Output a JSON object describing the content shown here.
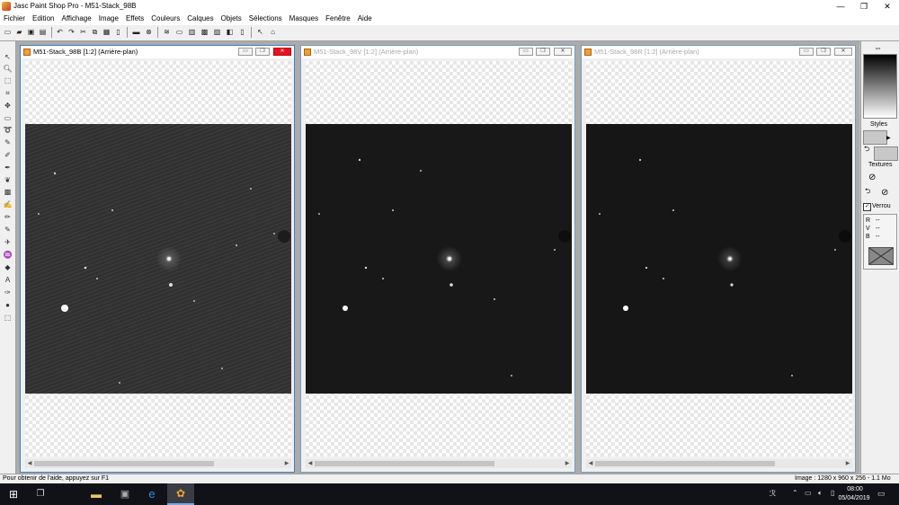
{
  "app": {
    "title": "Jasc Paint Shop Pro - M51-Stack_98B",
    "window_controls": {
      "minimize": "—",
      "maximize": "❐",
      "close": "✕"
    }
  },
  "menu": [
    "Fichier",
    "Edition",
    "Affichage",
    "Image",
    "Effets",
    "Couleurs",
    "Calques",
    "Objets",
    "Sélections",
    "Masques",
    "Fenêtre",
    "Aide"
  ],
  "windows": [
    {
      "title": "M51-Stack_98B [1:2] (Arrière-plan)",
      "active": true
    },
    {
      "title": "M51-Stack_98V [1:2] (Arrière-plan)",
      "active": false
    },
    {
      "title": "M51-Stack_98R [1:2] (Arrière-plan)",
      "active": false
    }
  ],
  "right_panel": {
    "styles_label": "Styles",
    "textures_label": "Textures",
    "verrou_label": "Verrou",
    "verrou_checked": true,
    "rgb": [
      {
        "label": "R",
        "value": "--"
      },
      {
        "label": "V",
        "value": "--"
      },
      {
        "label": "B",
        "value": "--"
      }
    ]
  },
  "status": {
    "help": "Pour obtenir de l'aide, appuyez sur F1",
    "image_info": "Image : 1280 x 960 x 256 - 1.1 Mo"
  },
  "taskbar": {
    "time": "08:00",
    "date": "05/04/2019"
  },
  "colors": {
    "accent": "#3d80c8",
    "close_red": "#e81123",
    "taskbar": "#101218"
  }
}
